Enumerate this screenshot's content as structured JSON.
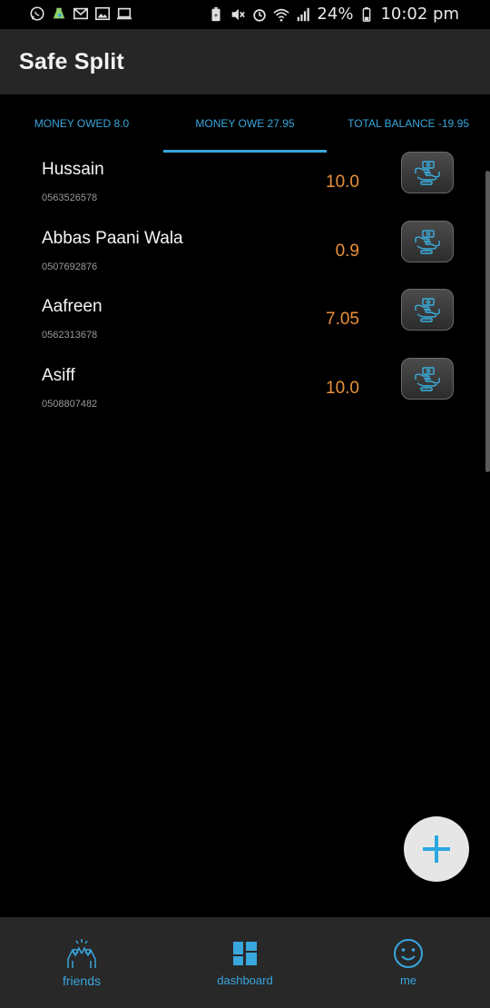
{
  "status_bar": {
    "battery": "24%",
    "time": "10:02 pm"
  },
  "app_bar": {
    "title": "Safe Split"
  },
  "tabs": [
    {
      "label": "MONEY OWED 8.0"
    },
    {
      "label": "MONEY OWE 27.95"
    },
    {
      "label": "TOTAL BALANCE -19.95"
    }
  ],
  "friends": [
    {
      "name": "Hussain",
      "phone": "0563526578",
      "amount": "10.0"
    },
    {
      "name": "Abbas Paani Wala",
      "phone": "0507692876",
      "amount": "0.9"
    },
    {
      "name": "Aafreen",
      "phone": "0562313678",
      "amount": "7.05"
    },
    {
      "name": "Asiff",
      "phone": "0508807482",
      "amount": "10.0"
    }
  ],
  "bottom_nav": {
    "friends": "friends",
    "dashboard": "dashboard",
    "me": "me"
  },
  "colors": {
    "accent": "#39a6dd",
    "amount": "#e8913a",
    "app_bar": "#262626"
  }
}
